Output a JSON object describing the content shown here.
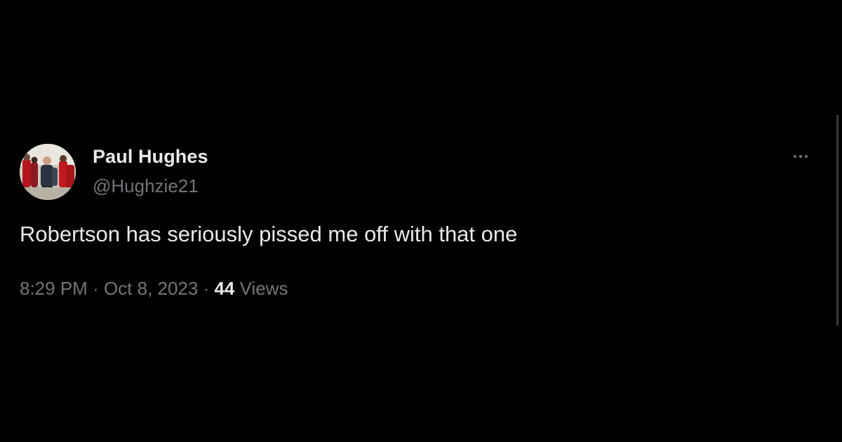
{
  "tweet": {
    "display_name": "Paul Hughes",
    "handle": "@Hughzie21",
    "text": "Robertson has seriously pissed me off with that one",
    "time": "8:29 PM",
    "separator": " · ",
    "date": "Oct 8, 2023",
    "views_count": "44",
    "views_label": "Views",
    "more_icon": "more-horizontal-icon"
  },
  "colors": {
    "background": "#000000",
    "primary_text": "#e7e9ea",
    "secondary_text": "#71767b"
  }
}
